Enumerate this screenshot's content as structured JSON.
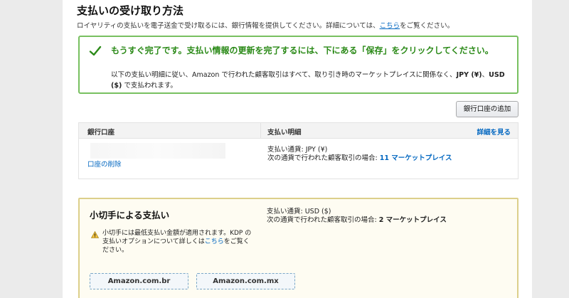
{
  "header": {
    "title": "支払いの受け取り方法",
    "subtitle_pre": "ロイヤリティの支払いを電子送金で受け取るには、銀行情報を提供してください。詳細については、",
    "subtitle_link": "こちら",
    "subtitle_post": "をご覧ください。"
  },
  "alert": {
    "heading": "もうすぐ完了です。支払い情報の更新を完了するには、下にある「保存」をクリックしてください。",
    "body_pre": "以下の支払い明細に従い、Amazon で行われた顧客取引はすべて、取り引き時のマーケットプレイスに関係なく、",
    "currency_jpy": "JPY (¥)",
    "body_mid": "、",
    "currency_usd": "USD ($)",
    "body_post": " で支払われます。"
  },
  "buttons": {
    "add_bank": "銀行口座の追加"
  },
  "bank_table": {
    "col_bank": "銀行口座",
    "col_detail": "支払い明細",
    "view_detail_link": "詳細を見る",
    "delete_link": "口座の削除",
    "currency_line": "支払い通貨: JPY (¥)",
    "market_line_pre": "次の通貨で行われた顧客取引の場合: ",
    "market_line_link": "11 マーケットプレイス"
  },
  "cheque": {
    "title": "小切手による支払い",
    "currency_line": "支払い通貨: USD ($)",
    "market_line_pre": "次の通貨で行われた顧客取引の場合: ",
    "market_line_bold": "2 マーケットプレイス",
    "warning_pre": "小切手には最低支払い金額が適用されます。KDP の支払いオプションについて詳しくは",
    "warning_link": "こちら",
    "warning_post": "をご覧ください。",
    "marketplaces": [
      "Amazon.com.br",
      "Amazon.com.mx"
    ]
  },
  "icons": {
    "check": "check-icon",
    "warning": "warning-icon"
  },
  "colors": {
    "success_green": "#2b8a18",
    "success_border": "#78c060",
    "link_blue": "#0066c0",
    "cheque_border": "#dccf8a",
    "cheque_bg": "#fefcf2"
  }
}
